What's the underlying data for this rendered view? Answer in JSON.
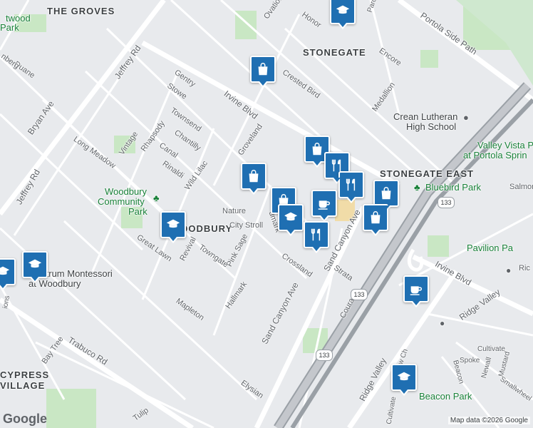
{
  "map": {
    "areas": {
      "the_groves": "THE GROVES",
      "stonegate": "STONEGATE",
      "stonegate_east": "STONEGATE EAST",
      "woodbury": "WOODBURY",
      "cypress_village_1": "CYPRESS",
      "cypress_village_2": "VILLAGE"
    },
    "parks": {
      "woodbury_1": "Woodbury",
      "woodbury_2": "Community",
      "woodbury_3": "Park",
      "bluebird": "Bluebird Park",
      "valley_vista_1": "Valley Vista Pa",
      "valley_vista_2": "at Portola Sprin",
      "pavilion": "Pavilion Pa",
      "beacon": "Beacon Park",
      "westwood_1": "twood",
      "westwood_2": "Park"
    },
    "schools": {
      "crean_1": "Crean Lutheran",
      "crean_2": "High School",
      "spectrum_1": "Spectrum Montessori",
      "spectrum_2": "at Woodbury"
    },
    "streets": {
      "jeffrey_rd_1": "Jeffrey Rd",
      "jeffrey_rd_2": "Jeffrey Rd",
      "bryan_ave": "Bryan Ave",
      "irvine_blvd_1": "Irvine Blvd",
      "irvine_blvd_2": "Irvine Blvd",
      "portola_side_path": "Portola Side Path",
      "sand_canyon_1": "Sand Canyon Ave",
      "sand_canyon_2": "Sand Canyon Ave",
      "trabuco": "Trabuco Rd",
      "ridge_valley_1": "Ridge Valley",
      "ridge_valley_2": "Ridge Valley",
      "duane": "Duane",
      "nberg": "nberg",
      "gentry": "Gentry",
      "stowe": "Stowe",
      "townsend": "Townsend",
      "chantilly": "Chantilly",
      "canal": "Canal",
      "rhapsody": "Rhapsody",
      "vintage": "Vintage",
      "long_meadow": "Long Meadow",
      "rinaldi": "Rinaldi",
      "wild_lilac": "Wild Lilac",
      "groveland": "Groveland",
      "crested_bird": "Crested Bird",
      "honor": "Honor",
      "ovation": "Ovation",
      "encore": "Encore",
      "medallion": "Medallion",
      "nature": "Nature",
      "city_stroll": "City Stroll",
      "landmark": "dmark",
      "pink_sage": "Pink Sage",
      "towngate": "Towngate",
      "revival": "Revival",
      "great_lawn": "Great Lawn",
      "hallmark": "Hallmark",
      "crossland": "Crossland",
      "strata": "Strata",
      "courant": "Courant",
      "mapleton": "Mapleton",
      "bay_tree": "Bay Tree",
      "elysian": "Elysian",
      "tulip": "Tulip",
      "salmon": "Salmon",
      "ric": "Ric",
      "cultivate": "Cultivate",
      "spoke": "Spoke",
      "newall": "Newall",
      "mustard": "Mustard",
      "beacon_st": "Beacon",
      "smallwheel": "Smallwheel",
      "follow": "Follow Ch",
      "cultivate_2": "Cultivate",
      "ions": "ions",
      "parc": "Parc"
    },
    "route_shield_1": "133",
    "route_shield_2": "133",
    "route_shield_3": "133"
  },
  "pins": [
    {
      "icon": "school-icon"
    },
    {
      "icon": "shopping-bag-icon"
    },
    {
      "icon": "shopping-bag-icon"
    },
    {
      "icon": "shopping-bag-icon"
    },
    {
      "icon": "restaurant-icon"
    },
    {
      "icon": "restaurant-icon"
    },
    {
      "icon": "shopping-bag-icon"
    },
    {
      "icon": "shopping-bag-icon"
    },
    {
      "icon": "coffee-icon"
    },
    {
      "icon": "school-icon"
    },
    {
      "icon": "restaurant-icon"
    },
    {
      "icon": "coffee-icon"
    },
    {
      "icon": "school-icon"
    },
    {
      "icon": "school-icon"
    },
    {
      "icon": "school-icon"
    }
  ],
  "footer": {
    "logo": "Google",
    "credit": "Map data ©2026 Google"
  },
  "colors": {
    "pin": "#1f6fb2",
    "park": "#c9e7c4",
    "highway": "#9aa0a6",
    "road": "#ffffff",
    "land": "#e8eaed"
  }
}
